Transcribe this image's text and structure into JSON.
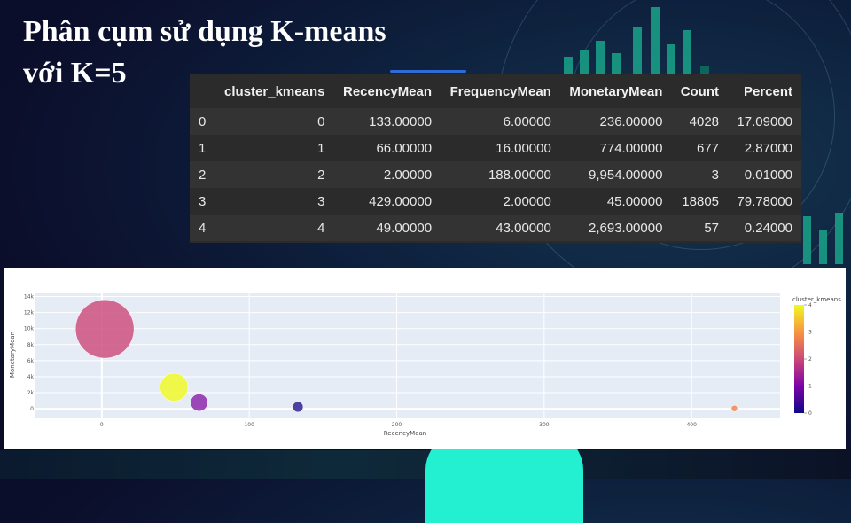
{
  "slide": {
    "title_line1": "Phân cụm sử dụng K-means",
    "title_line2": "với K=5"
  },
  "table": {
    "columns": [
      "",
      "cluster_kmeans",
      "RecencyMean",
      "FrequencyMean",
      "MonetaryMean",
      "Count",
      "Percent"
    ],
    "rows": [
      [
        "0",
        "0",
        "133.00000",
        "6.00000",
        "236.00000",
        "4028",
        "17.09000"
      ],
      [
        "1",
        "1",
        "66.00000",
        "16.00000",
        "774.00000",
        "677",
        "2.87000"
      ],
      [
        "2",
        "2",
        "2.00000",
        "188.00000",
        "9,954.00000",
        "3",
        "0.01000"
      ],
      [
        "3",
        "3",
        "429.00000",
        "2.00000",
        "45.00000",
        "18805",
        "79.78000"
      ],
      [
        "4",
        "4",
        "49.00000",
        "43.00000",
        "2,693.00000",
        "57",
        "0.24000"
      ]
    ]
  },
  "chart_data": {
    "type": "scatter",
    "xlabel": "RecencyMean",
    "ylabel": "MonetaryMean",
    "xlim": [
      -45,
      460
    ],
    "ylim": [
      -1200,
      14500
    ],
    "x_ticks": [
      0,
      100,
      200,
      300,
      400
    ],
    "x_tick_labels": [
      "0",
      "100",
      "200",
      "300",
      "400"
    ],
    "y_ticks": [
      0,
      2000,
      4000,
      6000,
      8000,
      10000,
      12000,
      14000
    ],
    "y_tick_labels": [
      "0",
      "2k",
      "4k",
      "6k",
      "8k",
      "10k",
      "12k",
      "14k"
    ],
    "grid": true,
    "points": [
      {
        "cluster": 0,
        "x": 133,
        "y": 236,
        "size": 6,
        "color": "#2a1a8c"
      },
      {
        "cluster": 1,
        "x": 66,
        "y": 774,
        "size": 16,
        "color": "#8b22a8"
      },
      {
        "cluster": 2,
        "x": 2,
        "y": 9954,
        "size": 188,
        "color": "#cc4a7a"
      },
      {
        "cluster": 3,
        "x": 429,
        "y": 45,
        "size": 2,
        "color": "#f0844c"
      },
      {
        "cluster": 4,
        "x": 49,
        "y": 2693,
        "size": 43,
        "color": "#f0f921"
      }
    ],
    "colorbar": {
      "title": "cluster_kmeans",
      "range": [
        0,
        4
      ],
      "ticks": [
        "0",
        "1",
        "2",
        "3",
        "4"
      ],
      "colors": [
        "#0d0887",
        "#7e03a8",
        "#cc4778",
        "#f89540",
        "#f0f921"
      ]
    },
    "plot_background": "#e5ecf6"
  }
}
